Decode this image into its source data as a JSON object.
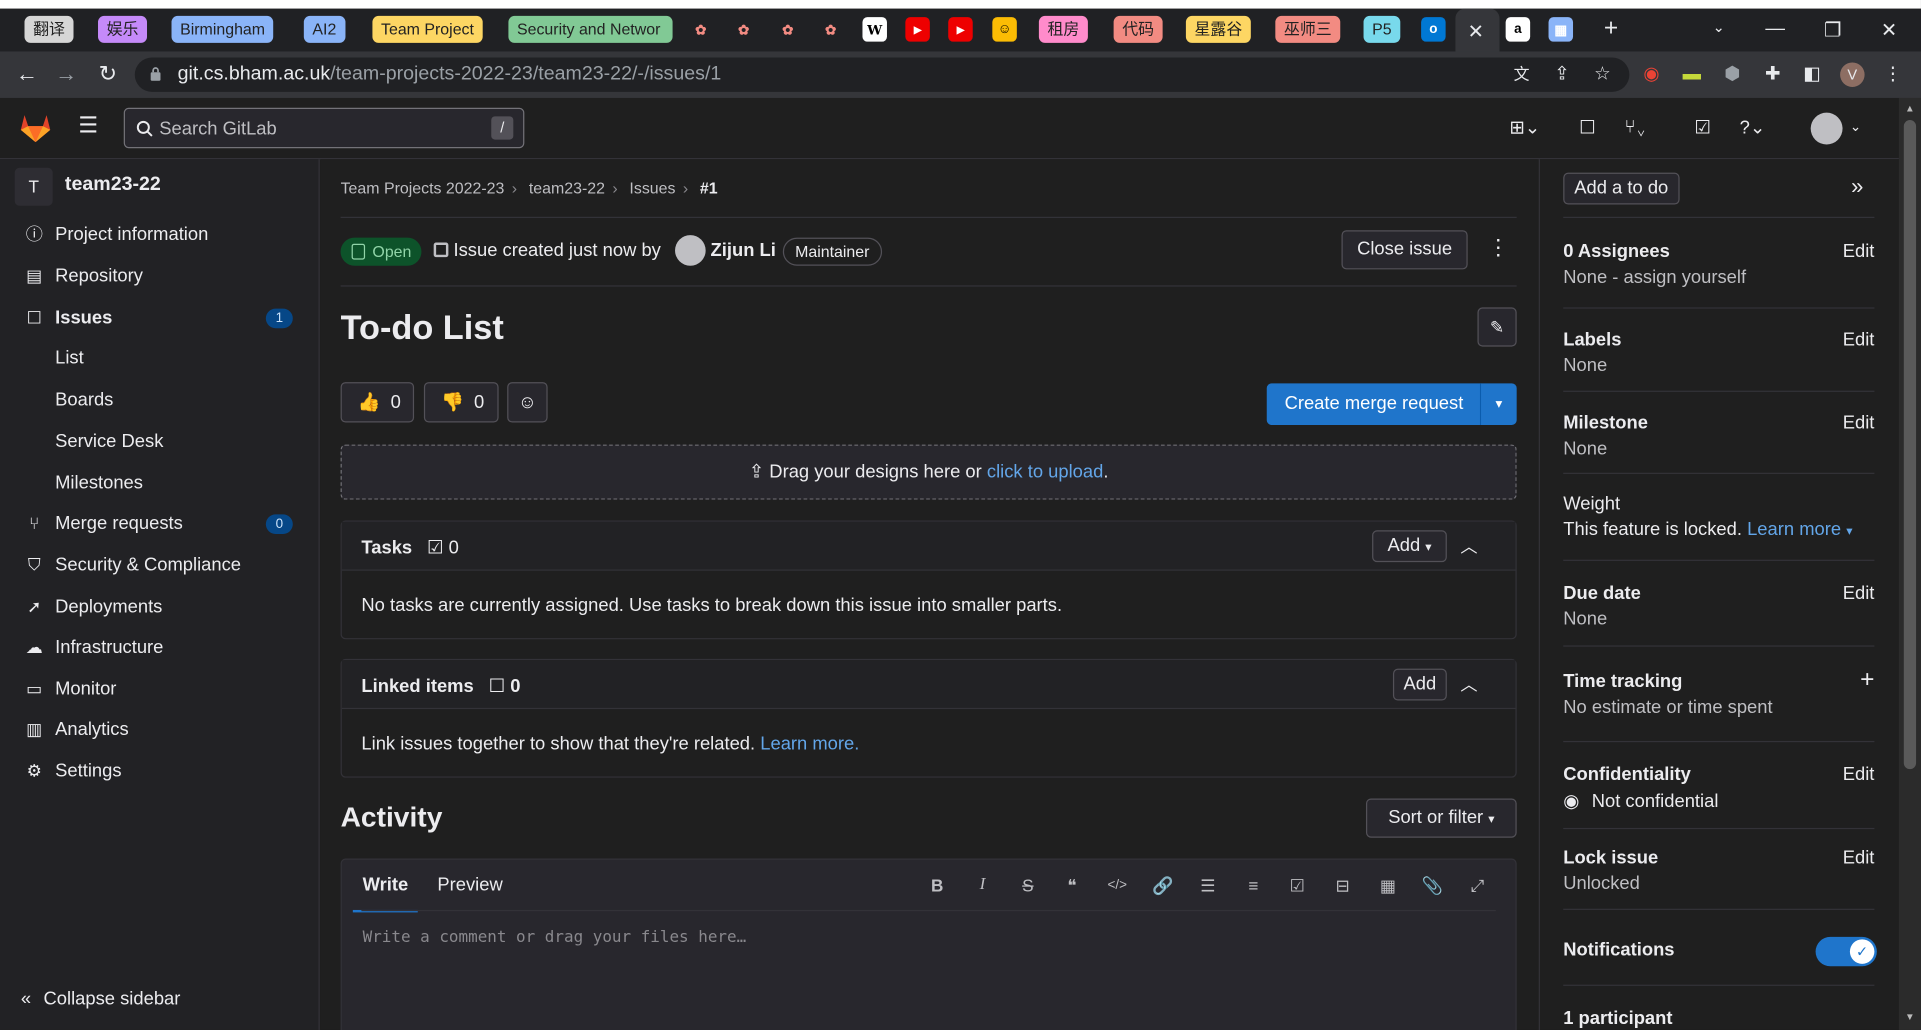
{
  "browser": {
    "tabs": [
      {
        "label": "翻译",
        "bg": "#d6d6d6"
      },
      {
        "label": "娱乐",
        "bg": "#c58af9"
      },
      {
        "label": "Birmingham",
        "bg": "#8ab4f8"
      },
      {
        "label": "AI2",
        "bg": "#8ab4f8"
      },
      {
        "label": "Team Project",
        "bg": "#fdd663"
      },
      {
        "label": "Security and Networ",
        "bg": "#81c995"
      },
      {
        "label": "租房",
        "bg": "#ff8bcb"
      },
      {
        "label": "代码",
        "bg": "#f28b82"
      },
      {
        "label": "星露谷",
        "bg": "#fdd663"
      },
      {
        "label": "巫师三",
        "bg": "#f28b82"
      },
      {
        "label": "P5",
        "bg": "#78d9ec"
      }
    ],
    "url_host": "git.cs.bham.ac.uk",
    "url_path": "/team-projects-2022-23/team23-22/-/issues/1",
    "profile_initial": "V"
  },
  "gitlab": {
    "search_placeholder": "Search GitLab",
    "search_shortcut": "/"
  },
  "sidebar": {
    "project_initial": "T",
    "project_name": "team23-22",
    "items": [
      {
        "label": "Project information",
        "icon": "info-icon"
      },
      {
        "label": "Repository",
        "icon": "doc-icon"
      },
      {
        "label": "Issues",
        "icon": "issues-icon",
        "count": "1"
      },
      {
        "label": "List"
      },
      {
        "label": "Boards"
      },
      {
        "label": "Service Desk"
      },
      {
        "label": "Milestones"
      },
      {
        "label": "Merge requests",
        "icon": "merge-icon",
        "count": "0"
      },
      {
        "label": "Security & Compliance",
        "icon": "shield-icon"
      },
      {
        "label": "Deployments",
        "icon": "rocket-icon"
      },
      {
        "label": "Infrastructure",
        "icon": "cloud-icon"
      },
      {
        "label": "Monitor",
        "icon": "monitor-icon"
      },
      {
        "label": "Analytics",
        "icon": "chart-icon"
      },
      {
        "label": "Settings",
        "icon": "gear-icon"
      }
    ],
    "collapse_label": "Collapse sidebar"
  },
  "breadcrumb": [
    "Team Projects 2022-23",
    "team23-22",
    "Issues",
    "#1"
  ],
  "issue": {
    "status": "Open",
    "created_text": "Issue created just now by",
    "author": "Zijun Li",
    "role": "Maintainer",
    "close_label": "Close issue",
    "title": "To-do List",
    "thumbs_up": "0",
    "thumbs_down": "0",
    "create_mr_label": "Create merge request",
    "dropzone_text": "Drag your designs here or",
    "dropzone_link": "click to upload",
    "dropzone_end": "."
  },
  "tasks": {
    "title": "Tasks",
    "count": "0",
    "add_label": "Add",
    "empty_text": "No tasks are currently assigned. Use tasks to break down this issue into smaller parts."
  },
  "linked": {
    "title": "Linked items",
    "count": "0",
    "add_label": "Add",
    "text": "Link issues together to show that they're related.",
    "link": "Learn more."
  },
  "activity": {
    "title": "Activity",
    "sort_label": "Sort or filter",
    "write_tab": "Write",
    "preview_tab": "Preview",
    "placeholder": "Write a comment or drag your files here…"
  },
  "right": {
    "todo_label": "Add a to do",
    "assignees_title": "0 Assignees",
    "assignees_value": "None - assign yourself",
    "labels_title": "Labels",
    "labels_value": "None",
    "milestone_title": "Milestone",
    "milestone_value": "None",
    "weight_title": "Weight",
    "weight_value": "This feature is locked.",
    "weight_link": "Learn more",
    "due_title": "Due date",
    "due_value": "None",
    "time_title": "Time tracking",
    "time_value": "No estimate or time spent",
    "conf_title": "Confidentiality",
    "conf_value": "Not confidential",
    "lock_title": "Lock issue",
    "lock_value": "Unlocked",
    "notif_title": "Notifications",
    "notifications_on": true,
    "participants": "1 participant",
    "edit_label": "Edit"
  }
}
